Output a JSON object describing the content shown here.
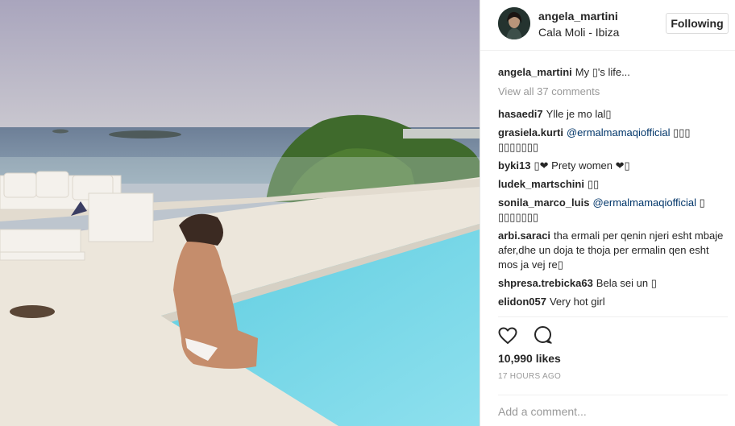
{
  "post": {
    "username": "angela_martini",
    "location": "Cala Moli - Ibiza",
    "follow_label": "Following",
    "caption_user": "angela_martini",
    "caption_text": "My ▯'s life...",
    "view_all": "View all 37 comments",
    "likes": "10,990 likes",
    "time": "17 HOURS AGO",
    "add_comment_placeholder": "Add a comment..."
  },
  "comments": [
    {
      "user": "hasaedi7",
      "mention": "",
      "text": "Ylle je mo lal▯"
    },
    {
      "user": "grasiela.kurti",
      "mention": "@ermalmamaqiofficial",
      "text": " ▯▯▯ ▯▯▯▯▯▯▯"
    },
    {
      "user": "byki13",
      "mention": "",
      "text": "▯❤ Prety women ❤▯"
    },
    {
      "user": "ludek_martschini",
      "mention": "",
      "text": "▯▯"
    },
    {
      "user": "sonila_marco_luis",
      "mention": "@ermalmamaqiofficial",
      "text": " ▯ ▯▯▯▯▯▯▯"
    },
    {
      "user": "arbi.saraci",
      "mention": "",
      "text": "tha ermali per qenin njeri esht mbaje afer,dhe un doja te thoja per ermalin qen esht mos ja vej re▯"
    },
    {
      "user": "shpresa.trebicka63",
      "mention": "",
      "text": "Bela sei un ▯"
    },
    {
      "user": "elidon057",
      "mention": "",
      "text": "Very hot girl"
    }
  ],
  "icons": {
    "like": "heart-icon",
    "comment": "comment-bubble-icon"
  }
}
